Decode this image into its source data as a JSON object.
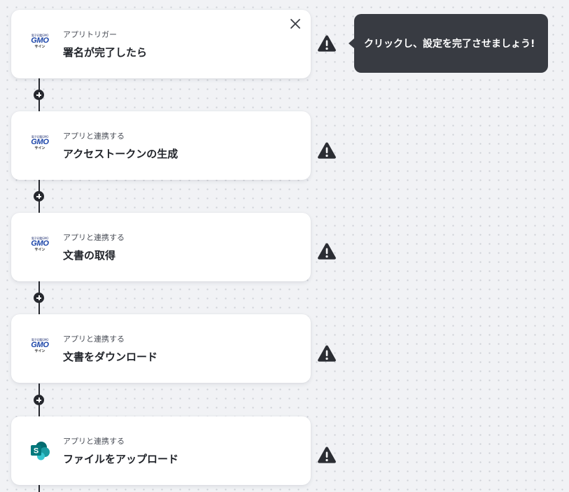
{
  "flow": {
    "steps": [
      {
        "type_label": "アプリトリガー",
        "title": "署名が完了したら",
        "app": "gmo-sign",
        "icon": "gmo-sign-logo-icon"
      },
      {
        "type_label": "アプリと連携する",
        "title": "アクセストークンの生成",
        "app": "gmo-sign",
        "icon": "gmo-sign-logo-icon"
      },
      {
        "type_label": "アプリと連携する",
        "title": "文書の取得",
        "app": "gmo-sign",
        "icon": "gmo-sign-logo-icon"
      },
      {
        "type_label": "アプリと連携する",
        "title": "文書をダウンロード",
        "app": "gmo-sign",
        "icon": "gmo-sign-logo-icon"
      },
      {
        "type_label": "アプリと連携する",
        "title": "ファイルをアップロード",
        "app": "sharepoint",
        "icon": "sharepoint-logo-icon"
      }
    ],
    "gmo_logo": {
      "top": "電子印鑑GMO",
      "main": "GMO",
      "sub": "サイン"
    },
    "sharepoint_letter": "S",
    "warning_icon": "warning-triangle-icon",
    "add_icon": "plus-circle-icon",
    "close_icon": "close-icon"
  },
  "tooltip": {
    "text": "クリックし、設定を完了させましょう!"
  },
  "colors": {
    "background": "#f1f2f5",
    "card": "#ffffff",
    "tooltip": "#383b42",
    "connector": "#26282e",
    "warning": "#2b2d33",
    "gmo_blue": "#1a44a8"
  }
}
